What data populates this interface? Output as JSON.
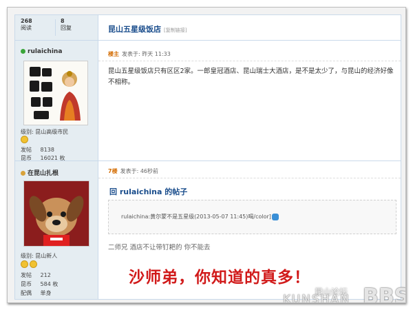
{
  "post1": {
    "stats": {
      "views_value": "268",
      "views_label": "阅读",
      "replies_value": "8",
      "replies_label": "回复"
    },
    "username": "rulaichina",
    "level_label": "级别:",
    "level_value": "昆山高级市民",
    "posts_label": "发帖",
    "posts_value": "8138",
    "coins_label": "昆币",
    "coins_value": "16021 枚",
    "thread_title": "昆山五星级饭店",
    "copy_link": "[复制链接]",
    "floor_label": "楼主",
    "posted_at": "发表于: 昨天 11:33",
    "content": "昆山五星级饭店只有区区2家。一郎皇冠酒店、昆山瑞士大酒店，是不是太少了，与昆山的经济好像不相称。"
  },
  "post2": {
    "username": "在昆山扎根",
    "level_label": "级别:",
    "level_value": "昆山新人",
    "posts_label": "发帖",
    "posts_value": "212",
    "coins_label": "昆币",
    "coins_value": "584 枚",
    "spouse_label": "配偶",
    "spouse_value": "单身",
    "floor_label": "7楼",
    "posted_at": "发表于: 46秒前",
    "reply_to": "回 rulaichina 的帖子",
    "quote_text": "rulaichina:黄尔蒙不是五星级(2013-05-07 11:45)喝/color]",
    "content": "二师兄 酒店不让带钉耙的 你不能去"
  },
  "overlay_text": "沙师弟，你知道的真多！",
  "watermark": {
    "cn": "昆山论坛",
    "en": "KUNSHAN",
    "bbs": "BBS"
  }
}
